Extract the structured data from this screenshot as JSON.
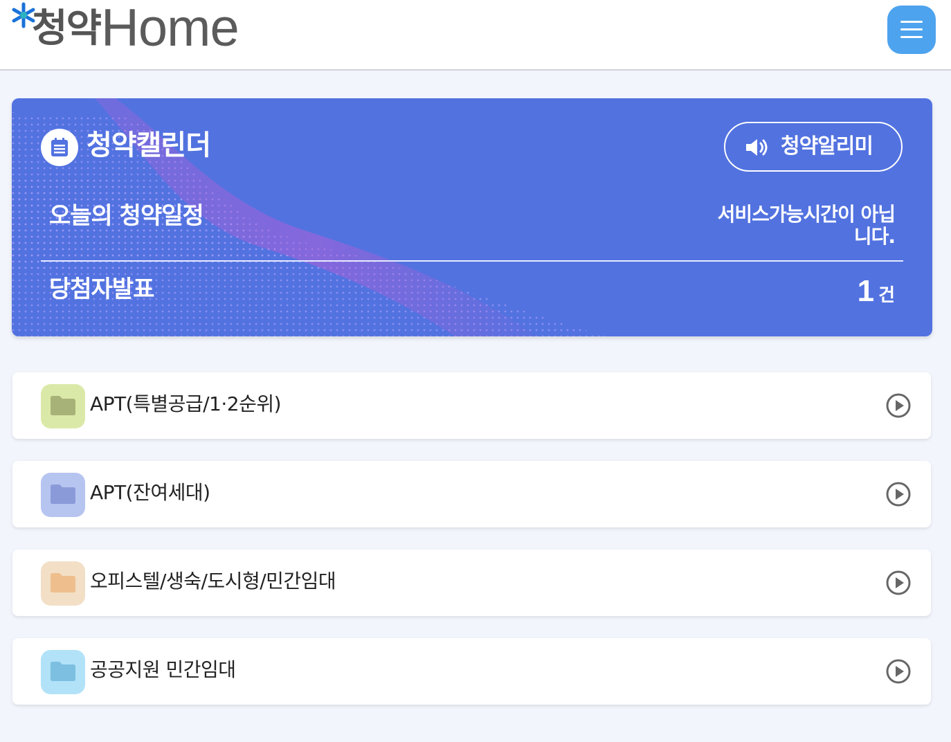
{
  "header": {
    "logo_kr": "청약",
    "logo_en": "Home",
    "menu_icon": "hamburger-menu-icon",
    "menu_color": "#4da3ee"
  },
  "calendar": {
    "title": "청약캘린더",
    "title_icon": "calendar-icon",
    "alarm_label": "청약알리미",
    "alarm_icon": "speaker-icon",
    "today_label": "오늘의 청약일정",
    "service_status": "서비스가능시간이 아닙니다.",
    "winner_label": "당첨자발표",
    "winner_count": "1",
    "winner_unit": "건",
    "background_color": "#5272e0"
  },
  "categories": [
    {
      "label": "APT(특별공급/1·2순위)",
      "icon": "folder-icon",
      "bg": "#dbe9a8",
      "fg": "#a6b277"
    },
    {
      "label": "APT(잔여세대)",
      "icon": "folder-icon",
      "bg": "#b6c4f0",
      "fg": "#8a9ad9"
    },
    {
      "label": "오피스텔/생숙/도시형/민간임대",
      "icon": "folder-icon",
      "bg": "#f2dfc6",
      "fg": "#eebf8c"
    },
    {
      "label": "공공지원 민간임대",
      "icon": "folder-icon",
      "bg": "#b2e2f8",
      "fg": "#7cbfe0"
    }
  ]
}
